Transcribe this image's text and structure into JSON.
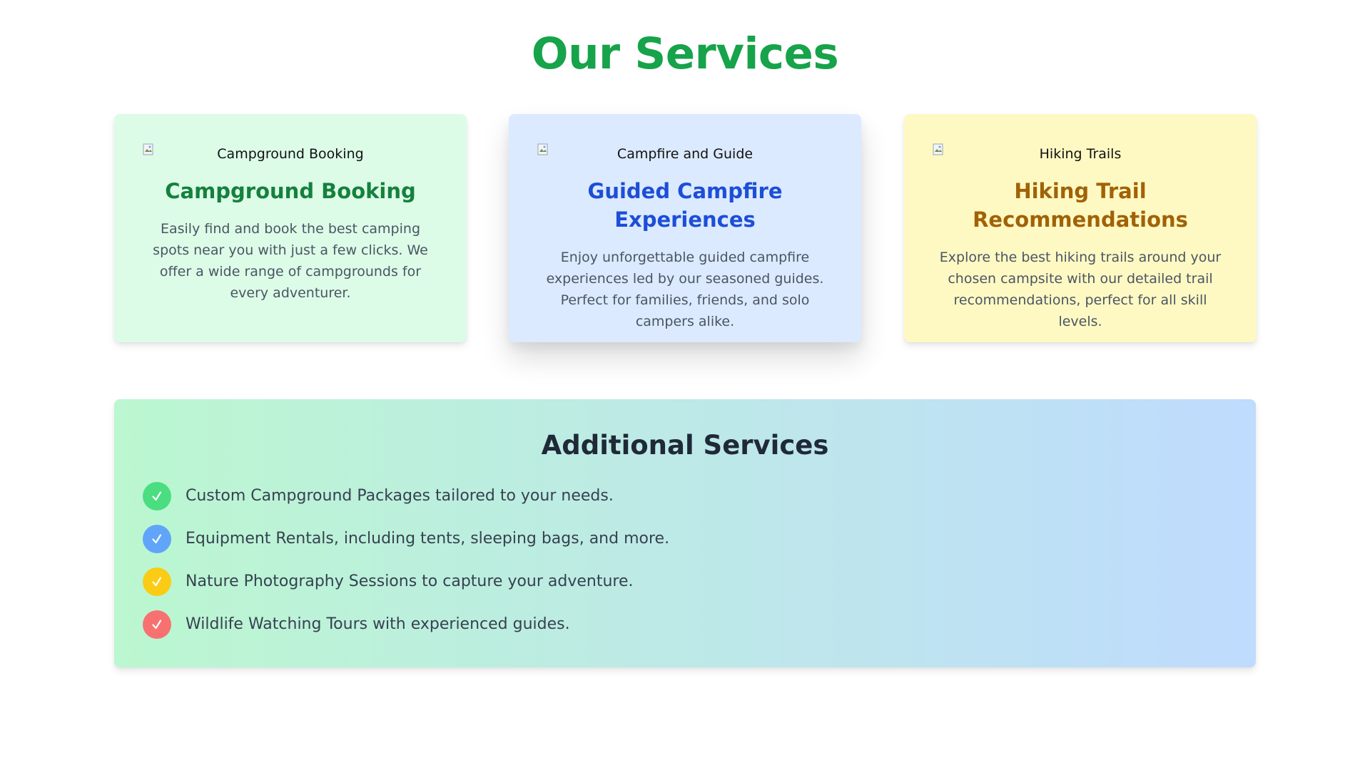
{
  "page": {
    "title": "Our Services",
    "title_color": "#16a34a"
  },
  "cards": [
    {
      "image_alt": "Campground Booking",
      "title": "Campground Booking",
      "description": "Easily find and book the best camping spots near you with just a few clicks. We offer a wide range of campgrounds for every adventurer.",
      "background": "#dcfce7",
      "title_color": "#15803d"
    },
    {
      "image_alt": "Campfire and Guide",
      "title": "Guided Campfire Experiences",
      "description": "Enjoy unforgettable guided campfire experiences led by our seasoned guides. Perfect for families, friends, and solo campers alike.",
      "background": "#dbeafe",
      "title_color": "#1d4ed8"
    },
    {
      "image_alt": "Hiking Trails",
      "title": "Hiking Trail Recommendations",
      "description": "Explore the best hiking trails around your chosen campsite with our detailed trail recommendations, perfect for all skill levels.",
      "background": "#fef9c3",
      "title_color": "#a16207"
    }
  ],
  "additional": {
    "title": "Additional Services",
    "gradient": [
      "#bbf7d0",
      "#bfdbfe"
    ],
    "items": [
      {
        "text": "Custom Campground Packages tailored to your needs.",
        "icon": "check-icon",
        "badge_color": "#4ade80"
      },
      {
        "text": "Equipment Rentals, including tents, sleeping bags, and more.",
        "icon": "check-icon",
        "badge_color": "#60a5fa"
      },
      {
        "text": "Nature Photography Sessions to capture your adventure.",
        "icon": "check-icon",
        "badge_color": "#facc15"
      },
      {
        "text": "Wildlife Watching Tours with experienced guides.",
        "icon": "check-icon",
        "badge_color": "#f87171"
      }
    ]
  }
}
